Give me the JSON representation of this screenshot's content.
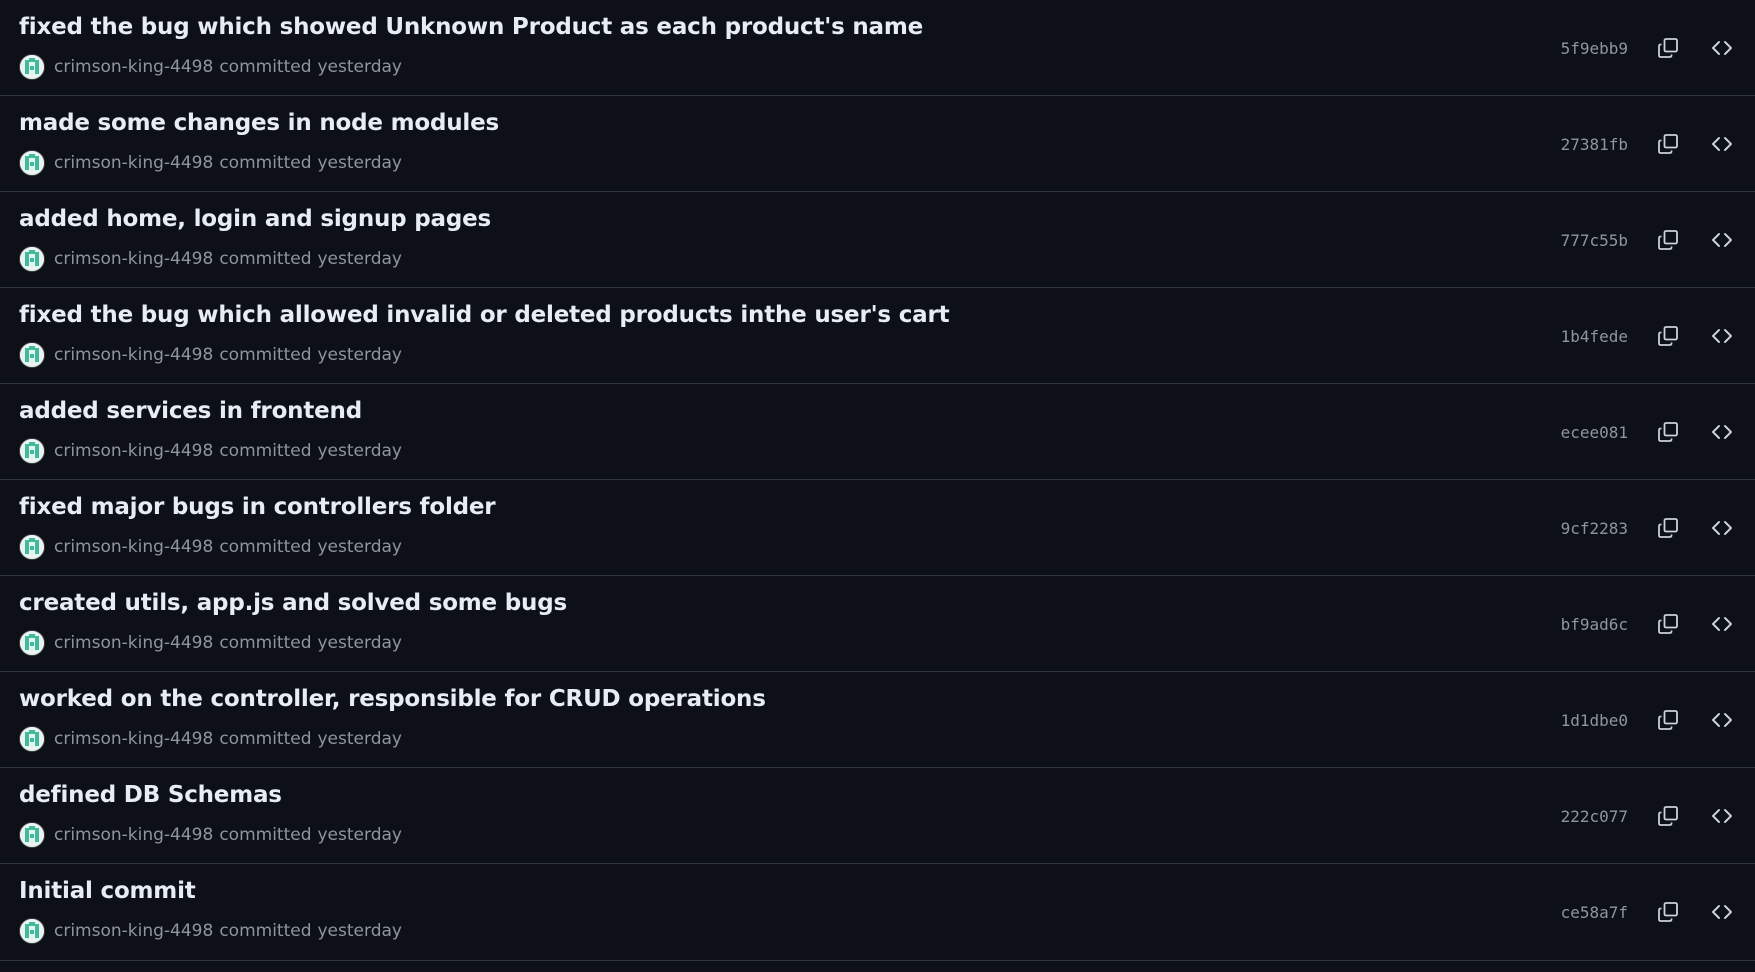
{
  "commits": [
    {
      "title": "fixed the bug which showed Unknown Product as each product's name",
      "author": "crimson-king-4498",
      "action": "committed",
      "time": "yesterday",
      "sha": "5f9ebb9"
    },
    {
      "title": "made some changes in node modules",
      "author": "crimson-king-4498",
      "action": "committed",
      "time": "yesterday",
      "sha": "27381fb"
    },
    {
      "title": "added home, login and signup pages",
      "author": "crimson-king-4498",
      "action": "committed",
      "time": "yesterday",
      "sha": "777c55b"
    },
    {
      "title": "fixed the bug which allowed invalid or deleted products inthe user's cart",
      "author": "crimson-king-4498",
      "action": "committed",
      "time": "yesterday",
      "sha": "1b4fede"
    },
    {
      "title": "added services in frontend",
      "author": "crimson-king-4498",
      "action": "committed",
      "time": "yesterday",
      "sha": "ecee081"
    },
    {
      "title": "fixed major bugs in controllers folder",
      "author": "crimson-king-4498",
      "action": "committed",
      "time": "yesterday",
      "sha": "9cf2283"
    },
    {
      "title": "created utils, app.js and solved some bugs",
      "author": "crimson-king-4498",
      "action": "committed",
      "time": "yesterday",
      "sha": "bf9ad6c"
    },
    {
      "title": "worked on the controller, responsible for CRUD operations",
      "author": "crimson-king-4498",
      "action": "committed",
      "time": "yesterday",
      "sha": "1d1dbe0"
    },
    {
      "title": "defined DB Schemas",
      "author": "crimson-king-4498",
      "action": "committed",
      "time": "yesterday",
      "sha": "222c077"
    },
    {
      "title": "Initial commit",
      "author": "crimson-king-4498",
      "action": "committed",
      "time": "yesterday",
      "sha": "ce58a7f"
    }
  ],
  "icons": {
    "copy": "copy-icon",
    "browse": "code-icon",
    "avatar": "identicon-avatar"
  },
  "colors": {
    "background": "#0d1117",
    "title": "#e6edf3",
    "muted": "#8d96a0",
    "border": "#30363d",
    "avatar_accent": "#3fb9a0"
  }
}
